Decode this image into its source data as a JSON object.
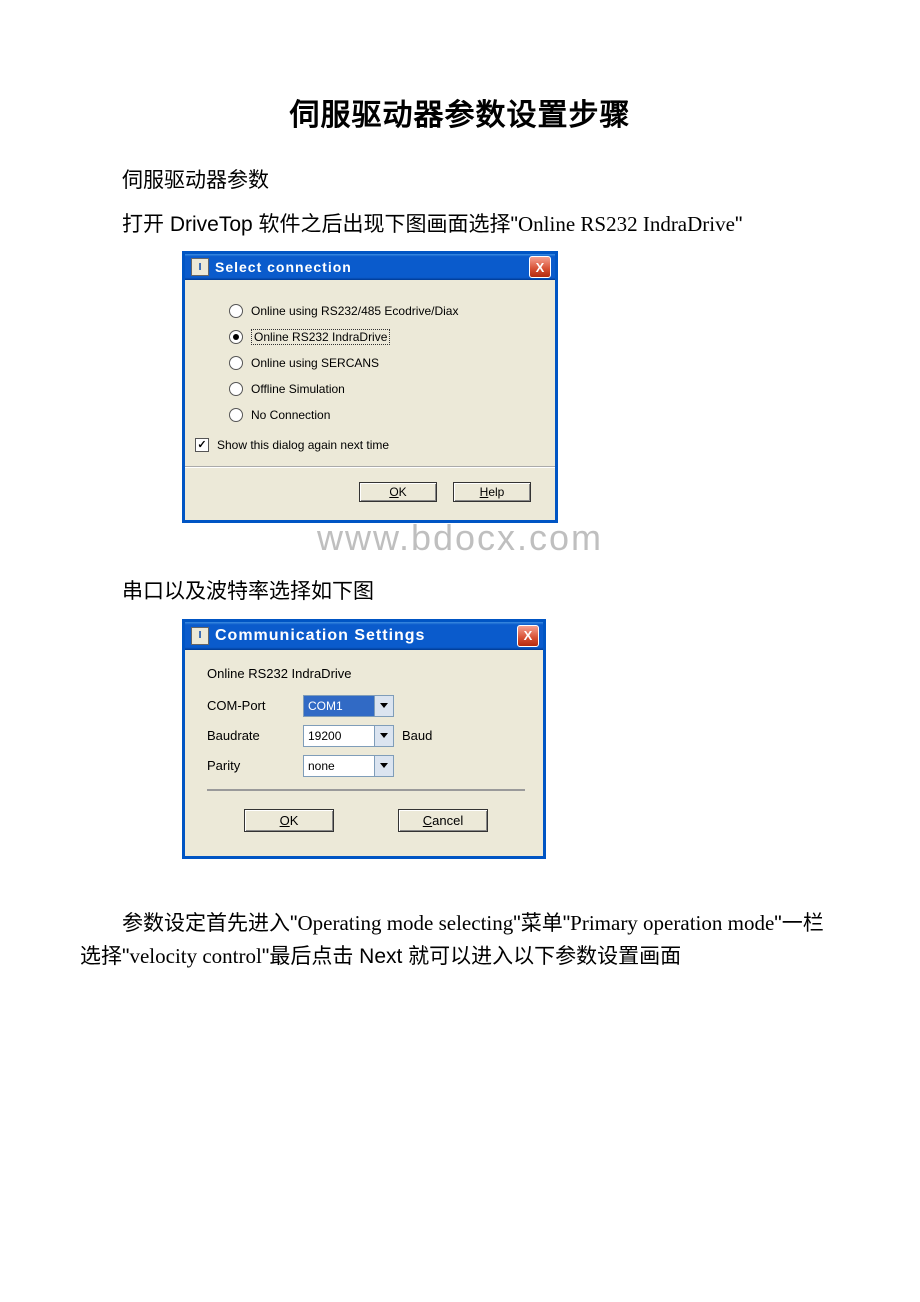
{
  "doc": {
    "title": "伺服驱动器参数设置步骤",
    "p1": "伺服驱动器参数",
    "p2_a": "打开 DriveTop 软件之后出现下图画面选择\"",
    "p2_b": "Online RS232 IndraDrive",
    "p2_c": "\"",
    "p3": "串口以及波特率选择如下图",
    "p4_a": "参数设定首先进入\"",
    "p4_b": "Operating mode selecting",
    "p4_c": "\"菜单\"",
    "p4_d": "Primary operation mode",
    "p4_e": "\"一栏选择\"",
    "p4_f": "velocity control",
    "p4_g": "\"最后点击 Next 就可以进入以下参数设置画面"
  },
  "dialog1": {
    "title": "Select connection",
    "close": "X",
    "opt1": "Online using RS232/485 Ecodrive/Diax",
    "opt2": "Online RS232 IndraDrive",
    "opt3": "Online using SERCANS",
    "opt4": "Offline Simulation",
    "opt5": "No Connection",
    "chk": "Show this dialog again next time",
    "ok_u": "O",
    "ok_r": "K",
    "help_u": "H",
    "help_r": "elp"
  },
  "watermark": "www.bdocx.com",
  "dialog2": {
    "title": "Communication Settings",
    "close": "X",
    "sub": "Online RS232 IndraDrive",
    "f1_lbl": "COM-Port",
    "f1_val": "COM1",
    "f2_lbl": "Baudrate",
    "f2_val": "19200",
    "f2_unit": "Baud",
    "f3_lbl": "Parity",
    "f3_val": "none",
    "ok_u": "O",
    "ok_r": "K",
    "cancel_u": "C",
    "cancel_r": "ancel"
  }
}
